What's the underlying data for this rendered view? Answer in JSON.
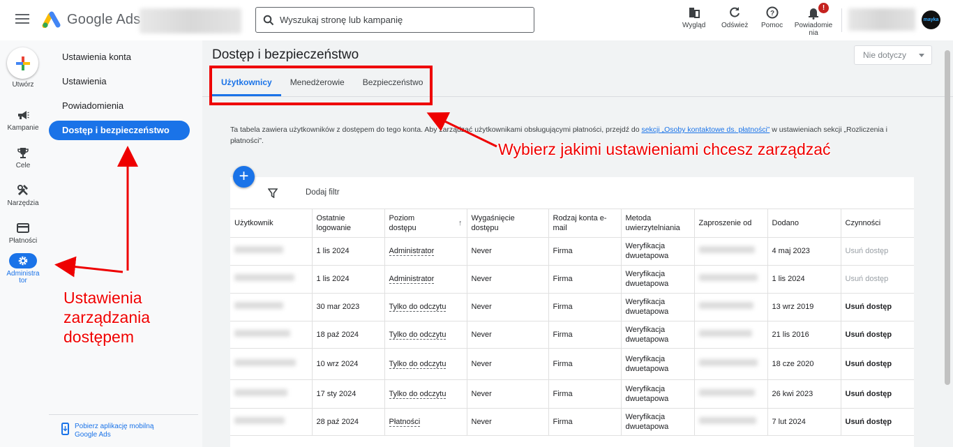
{
  "header": {
    "app_name_first": "Google",
    "app_name_second": "Ads",
    "search_placeholder": "Wyszukaj stronę lub kampanię",
    "tools": [
      {
        "label": "Wygląd"
      },
      {
        "label": "Odśwież"
      },
      {
        "label": "Pomoc"
      },
      {
        "label": "Powiadomienia",
        "label_line1": "Powiadomie",
        "label_line2": "nia",
        "badge": "!"
      }
    ],
    "avatar_text": "mayka"
  },
  "rail": {
    "create_label": "Utwórz",
    "items": [
      {
        "label": "Kampanie"
      },
      {
        "label": "Cele"
      },
      {
        "label": "Narzędzia"
      },
      {
        "label": "Płatności"
      },
      {
        "label_line1": "Administra",
        "label_line2": "tor",
        "active": true
      }
    ]
  },
  "nav": {
    "items": [
      {
        "label": "Ustawienia konta"
      },
      {
        "label": "Ustawienia"
      },
      {
        "label": "Powiadomienia"
      },
      {
        "label": "Dostęp i bezpieczeństwo",
        "active": true
      }
    ],
    "mobile_app_link": "Pobierz aplikację mobilną Google Ads"
  },
  "main": {
    "title": "Dostęp i bezpieczeństwo",
    "selector_value": "Nie dotyczy",
    "tabs": [
      {
        "label": "Użytkownicy",
        "active": true
      },
      {
        "label": "Menedżerowie"
      },
      {
        "label": "Bezpieczeństwo"
      }
    ],
    "info_text_before": "Ta tabela zawiera użytkowników z dostępem do tego konta. Aby zarządzać użytkownikami obsługującymi płatności, przejdź do ",
    "info_link": "sekcji „Osoby kontaktowe ds. płatności”",
    "info_text_after": " w ustawieniach sekcji „Rozliczenia i płatności”.",
    "add_filter": "Dodaj filtr",
    "fab_label": "+",
    "columns": [
      "Użytkownik",
      "Ostatnie logowanie",
      "Poziom dostępu",
      "Wygaśnięcie dostępu",
      "Rodzaj konta e-mail",
      "Metoda uwierzytelniania",
      "Zaproszenie od",
      "Dodano",
      "Czynności"
    ],
    "rows": [
      {
        "last_login": "1 lis 2024",
        "access": "Administrator",
        "expiry": "Never",
        "email_type": "Firma",
        "auth": "Weryfikacja dwuetapowa",
        "added": "4 maj 2023",
        "action": "Usuń dostęp",
        "action_enabled": false
      },
      {
        "last_login": "1 lis 2024",
        "access": "Administrator",
        "expiry": "Never",
        "email_type": "Firma",
        "auth": "Weryfikacja dwuetapowa",
        "added": "1 lis 2024",
        "action": "Usuń dostęp",
        "action_enabled": false
      },
      {
        "last_login": "30 mar 2023",
        "access": "Tylko do odczytu",
        "expiry": "Never",
        "email_type": "Firma",
        "auth": "Weryfikacja dwuetapowa",
        "added": "13 wrz 2019",
        "action": "Usuń dostęp",
        "action_enabled": true
      },
      {
        "last_login": "18 paź 2024",
        "access": "Tylko do odczytu",
        "expiry": "Never",
        "email_type": "Firma",
        "auth": "Weryfikacja dwuetapowa",
        "added": "21 lis 2016",
        "action": "Usuń dostęp",
        "action_enabled": true
      },
      {
        "last_login": "10 wrz 2024",
        "access": "Tylko do odczytu",
        "expiry": "Never",
        "email_type": "Firma",
        "auth": "Weryfikacja dwuetapowa",
        "added": "18 cze 2020",
        "action": "Usuń dostęp",
        "action_enabled": true
      },
      {
        "last_login": "17 sty 2024",
        "access": "Tylko do odczytu",
        "expiry": "Never",
        "email_type": "Firma",
        "auth": "Weryfikacja dwuetapowa",
        "added": "26 kwi 2023",
        "action": "Usuń dostęp",
        "action_enabled": true
      },
      {
        "last_login": "28 paź 2024",
        "access": "Płatności",
        "expiry": "Never",
        "email_type": "Firma",
        "auth": "Weryfikacja dwuetapowa",
        "added": "7 lut 2024",
        "action": "Usuń dostęp",
        "action_enabled": true
      }
    ]
  },
  "annotations": {
    "tabs_note": "Wybierz jakimi ustawieniami chcesz zarządzać",
    "access_note_line1": "Ustawienia",
    "access_note_line2": "zarządzania",
    "access_note_line3": "dostępem",
    "color": "#e00000"
  },
  "colors": {
    "accent": "#1a73e8",
    "annotation_red": "#e00000"
  }
}
